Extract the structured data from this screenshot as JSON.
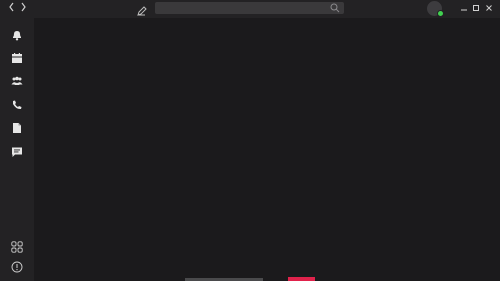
{
  "titlebar": {
    "nav_back_icon": "chevron-left-icon",
    "nav_forward_icon": "chevron-right-icon",
    "compose_icon": "compose-icon",
    "search": {
      "value": "",
      "placeholder": ""
    },
    "presence_color": "#41d150"
  },
  "window_controls": {
    "minimize": "minimize-icon",
    "maximize": "maximize-icon",
    "close": "close-icon"
  },
  "sidebar": {
    "items": [
      {
        "icon": "bell-icon",
        "name": "activity"
      },
      {
        "icon": "calendar-icon",
        "name": "calendar"
      },
      {
        "icon": "people-icon",
        "name": "teams"
      },
      {
        "icon": "phone-icon",
        "name": "calls"
      },
      {
        "icon": "file-icon",
        "name": "files"
      },
      {
        "icon": "chat-icon",
        "name": "chat"
      }
    ],
    "bottom": [
      {
        "icon": "apps-icon",
        "name": "apps"
      },
      {
        "icon": "info-icon",
        "name": "help"
      }
    ]
  },
  "bottom_bar": {
    "accent_color": "#e0224b"
  }
}
